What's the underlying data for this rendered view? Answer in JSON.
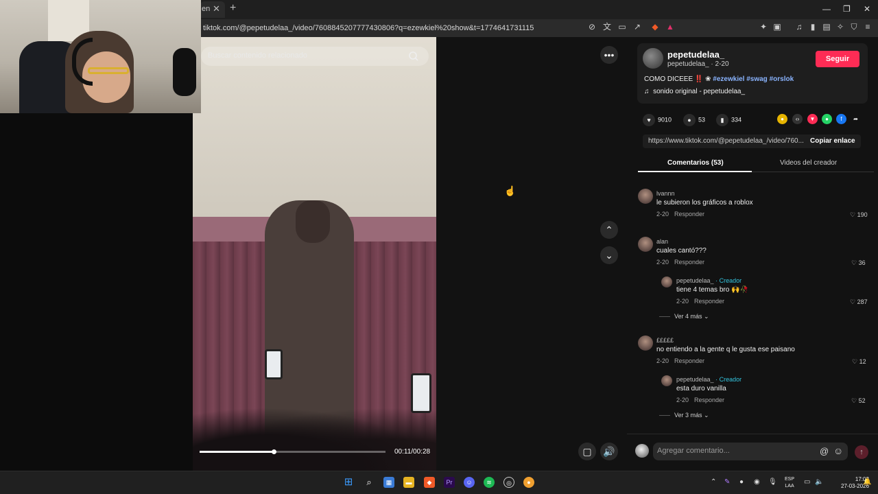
{
  "browser": {
    "tab_label": "en",
    "url": "tiktok.com/@pepetudelaa_/video/7608845207777430806?q=ezewkiel%20show&t=1774641731115"
  },
  "video": {
    "search_placeholder": "Buscar contenido relacionado",
    "time": "00:11/00:28",
    "progress": 0.4
  },
  "post": {
    "username": "pepetudelaa_",
    "subline": "pepetudelaa_ · 2-20",
    "follow_label": "Seguir",
    "desc_prefix": "COMO DICEEE ‼️ ❀",
    "hashtags": "#ezewkiel #swag #orslok",
    "sound": "sonido original - pepetudelaa_",
    "likes": "9010",
    "comments_count": "53",
    "saves": "334",
    "link": "https://www.tiktok.com/@pepetudelaa_/video/760...",
    "copy_label": "Copiar enlace",
    "tab_comments": "Comentarios (53)",
    "tab_videos": "Videos del creador"
  },
  "comments": [
    {
      "name": "lvannn",
      "text": "le subieron los gráficos a roblox",
      "date": "2-20",
      "reply": "Responder",
      "likes": "190"
    },
    {
      "name": "alan",
      "text": "cuales cantó???",
      "date": "2-20",
      "reply": "Responder",
      "likes": "36"
    },
    {
      "name": "£££££",
      "text": "no entiendo a la gente q le gusta ese paisano",
      "date": "2-20",
      "reply": "Responder",
      "likes": "12"
    }
  ],
  "replies": [
    {
      "name": "pepetudelaa_",
      "creator": "· Creador",
      "text": "tiene 4 temas bro 🙌🥀",
      "date": "2-20",
      "reply": "Responder",
      "likes": "287",
      "more": "Ver 4 más"
    },
    {
      "name": "pepetudelaa_",
      "creator": "· Creador",
      "text": "esta duro vanilla",
      "date": "2-20",
      "reply": "Responder",
      "likes": "52",
      "more": "Ver 3 más"
    }
  ],
  "comment_input": {
    "placeholder": "Agregar comentario..."
  },
  "taskbar": {
    "lang_line1": "ESP",
    "lang_line2": "LAA",
    "time": "17:02",
    "date": "27-03-2026"
  },
  "colors": {
    "accent": "#fe2c55",
    "creator": "#34c6e0",
    "hashtag": "#8ab4ff"
  }
}
